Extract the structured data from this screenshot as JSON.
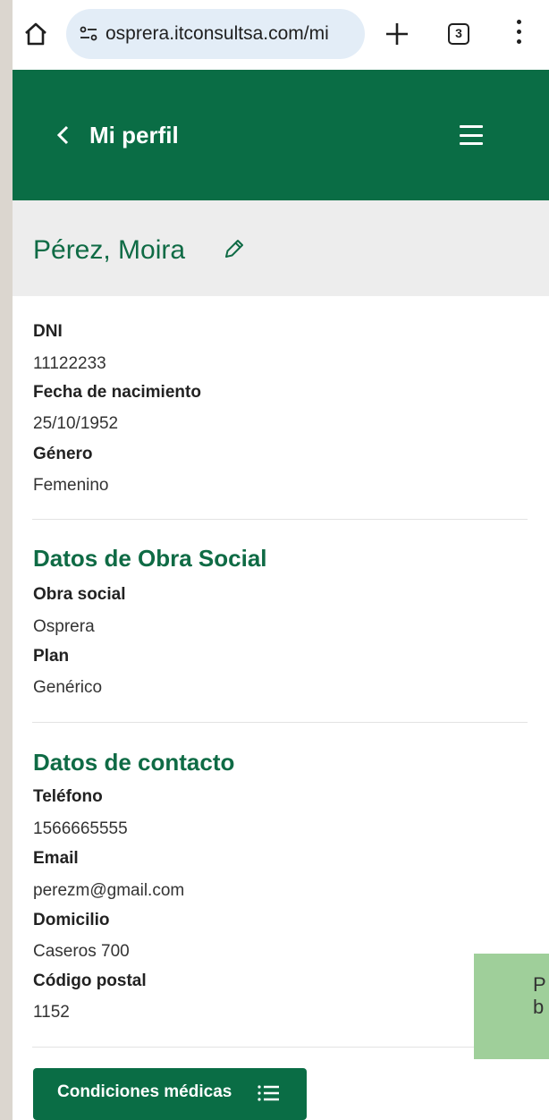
{
  "browser": {
    "url": "osprera.itconsultsa.com/mi",
    "tab_count": "3"
  },
  "header": {
    "back_label": "<",
    "title": "Mi perfil"
  },
  "profile": {
    "name": "Pérez, Moira"
  },
  "personal": {
    "fields": [
      {
        "label": "DNI",
        "value": "11122233"
      },
      {
        "label": "Fecha de nacimiento",
        "value": "25/10/1952"
      },
      {
        "label": "Género",
        "value": "Femenino"
      }
    ]
  },
  "obra_social": {
    "title": "Datos de Obra Social",
    "fields": [
      {
        "label": "Obra social",
        "value": "Osprera"
      },
      {
        "label": "Plan",
        "value": "Genérico"
      }
    ]
  },
  "contacto": {
    "title": "Datos de contacto",
    "fields": [
      {
        "label": "Teléfono",
        "value": "1566665555"
      },
      {
        "label": "Email",
        "value": "perezm@gmail.com"
      },
      {
        "label": "Domicilio",
        "value": "Caseros 700"
      },
      {
        "label": "Código postal",
        "value": "1152"
      }
    ]
  },
  "toast": {
    "text": "P\nb"
  },
  "actions": {
    "condiciones_label": "Condiciones médicas"
  },
  "colors": {
    "brand_green": "#0a6d45",
    "toast_green": "#9fcf9a"
  },
  "icons": [
    "home-icon",
    "site-settings-icon",
    "new-tab-icon",
    "tab-switcher-icon",
    "more-options-icon",
    "back-chevron-icon",
    "hamburger-menu-icon",
    "pencil-edit-icon",
    "list-icon"
  ]
}
